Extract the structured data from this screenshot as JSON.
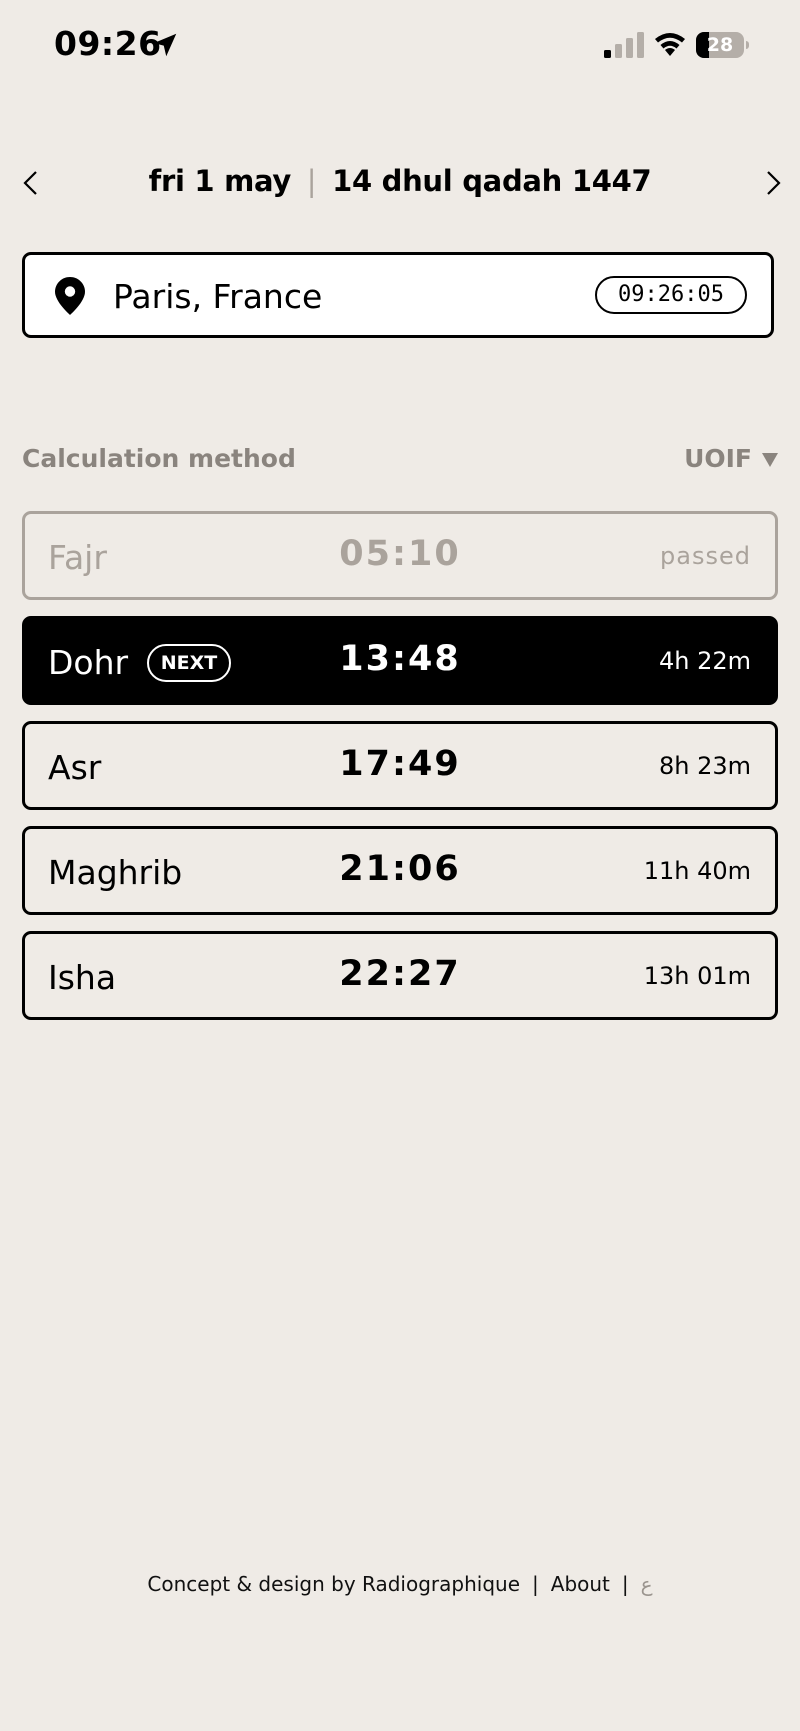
{
  "status_bar": {
    "time": "09:26",
    "battery": "28",
    "battery_level": 0.28
  },
  "date_nav": {
    "gregorian": "fri 1 may",
    "separator": "|",
    "hijri": "14 dhul qadah 1447"
  },
  "location": {
    "name": "Paris, France",
    "clock": "09:26:05"
  },
  "calculation": {
    "label": "Calculation method",
    "method": "UOIF"
  },
  "prayers": [
    {
      "name": "Fajr",
      "time": "05:10",
      "remaining": "passed",
      "state": "passed"
    },
    {
      "name": "Dohr",
      "time": "13:48",
      "remaining": "4h 22m",
      "state": "next",
      "badge": "NEXT"
    },
    {
      "name": "Asr",
      "time": "17:49",
      "remaining": "8h 23m",
      "state": "upcoming"
    },
    {
      "name": "Maghrib",
      "time": "21:06",
      "remaining": "11h 40m",
      "state": "upcoming"
    },
    {
      "name": "Isha",
      "time": "22:27",
      "remaining": "13h 01m",
      "state": "upcoming"
    }
  ],
  "footer": {
    "credit": "Concept & design by Radiographique",
    "about": "About",
    "language": "ع",
    "separator": "|"
  },
  "colors": {
    "background": "#efebe6",
    "muted": "#aaa39c",
    "label": "#8a847e",
    "accent": "#000000"
  }
}
